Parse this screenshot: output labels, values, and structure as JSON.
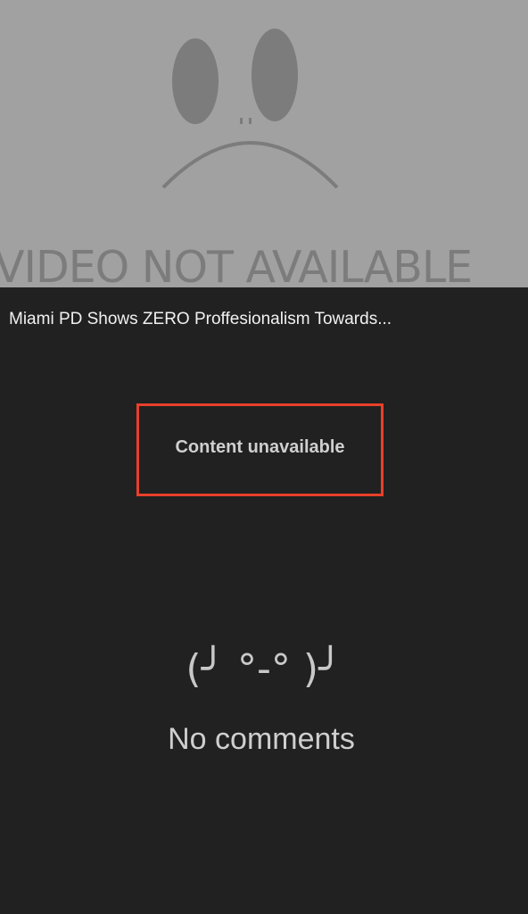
{
  "video": {
    "placeholder_text": "VIDEO NOT AVAILABLE",
    "title": "Miami PD Shows ZERO Proffesionalism Towards..."
  },
  "content_status": "Content unavailable",
  "comments": {
    "emoticon": "(╯ °-° )╯",
    "empty_text": "No comments"
  },
  "colors": {
    "video_bg": "#a1a1a1",
    "page_bg": "#212121",
    "highlight_border": "#e8402a"
  }
}
